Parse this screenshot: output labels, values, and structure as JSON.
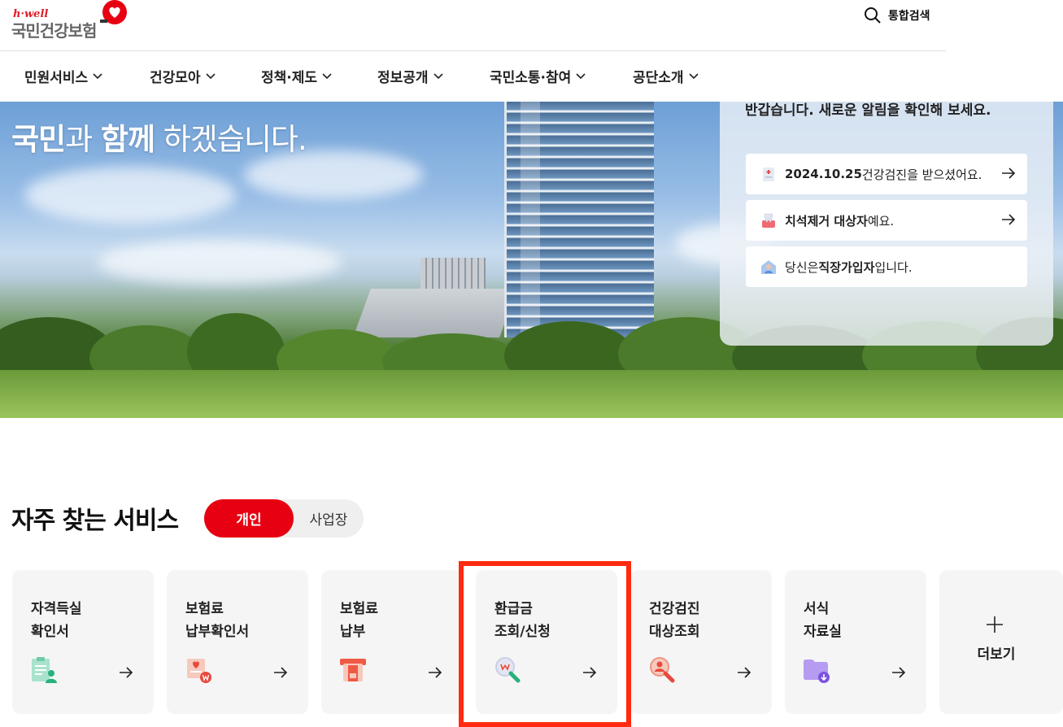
{
  "header": {
    "logo_tagline": "h·well",
    "logo_name": "국민건강보험",
    "search_label": "통합검색"
  },
  "nav": {
    "items": [
      {
        "label": "민원서비스"
      },
      {
        "label": "건강모아"
      },
      {
        "label": "정책·제도"
      },
      {
        "label": "정보공개"
      },
      {
        "label": "국민소통·참여"
      },
      {
        "label": "공단소개"
      }
    ]
  },
  "hero": {
    "headline_part1": "국민",
    "headline_part2": "과 ",
    "headline_part3": "함께",
    "headline_part4": " 하겠습니다."
  },
  "panel": {
    "title": "반갑습니다. 새로운 알림을 확인해 보세요.",
    "notices": [
      {
        "bold": "2024.10.25",
        "text": "건강검진을 받으셨어요.",
        "icon": "checkup-doc-icon"
      },
      {
        "bold": "치석제거 대상자",
        "text": "예요.",
        "icon": "dental-icon"
      },
      {
        "prefix": "당신은 ",
        "bold": "직장가입자",
        "text": "입니다.",
        "icon": "employee-icon"
      }
    ]
  },
  "services": {
    "title": "자주 찾는 서비스",
    "tab_personal": "개인",
    "tab_business": "사업장",
    "cards": [
      {
        "label": "자격득실\n확인서",
        "icon": "certificate-person-icon"
      },
      {
        "label": "보험료\n납부확인서",
        "icon": "payment-certificate-icon"
      },
      {
        "label": "보험료\n납부",
        "icon": "payment-icon"
      },
      {
        "label": "환급금\n조회/신청",
        "icon": "refund-search-icon"
      },
      {
        "label": "건강검진\n대상조회",
        "icon": "checkup-search-icon"
      },
      {
        "label": "서식\n자료실",
        "icon": "download-folder-icon"
      }
    ],
    "more_label": "더보기"
  },
  "colors": {
    "accent": "#e60012",
    "highlight": "#ff2a10"
  }
}
